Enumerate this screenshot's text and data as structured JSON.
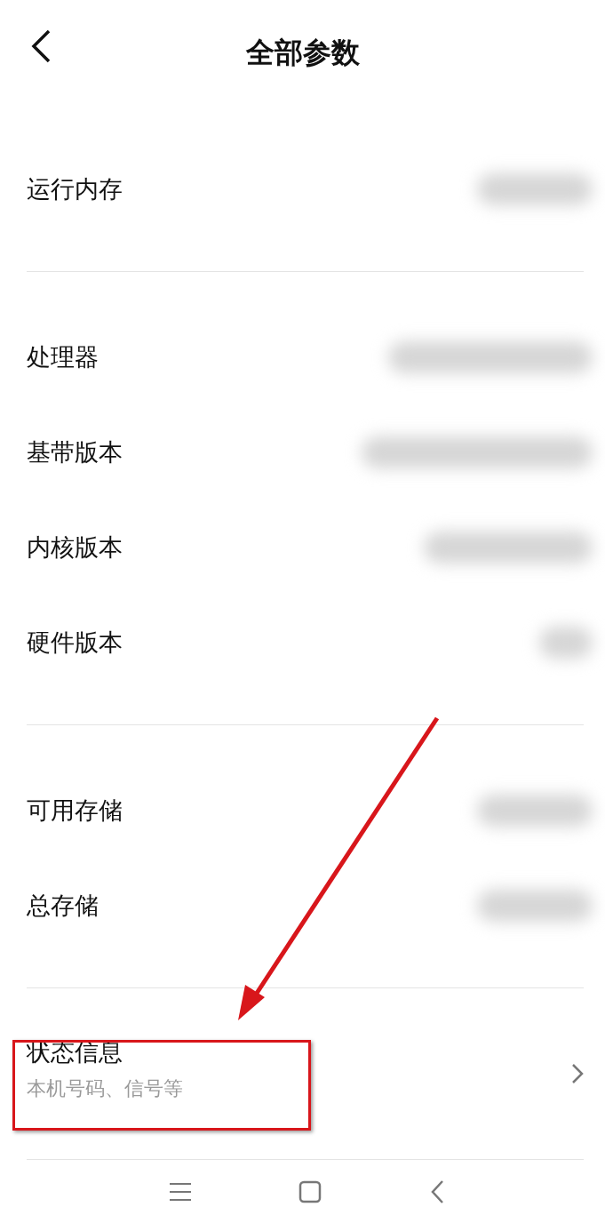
{
  "header": {
    "title": "全部参数"
  },
  "sections": [
    {
      "rows": [
        {
          "label": "运行内存",
          "blurred": true
        }
      ]
    },
    {
      "rows": [
        {
          "label": "处理器",
          "blurred": true
        },
        {
          "label": "基带版本",
          "blurred": true
        },
        {
          "label": "内核版本",
          "blurred": true
        },
        {
          "label": "硬件版本",
          "blurred": true
        }
      ]
    },
    {
      "rows": [
        {
          "label": "可用存储",
          "blurred": true
        },
        {
          "label": "总存储",
          "blurred": true
        }
      ]
    }
  ],
  "status_row": {
    "title": "状态信息",
    "subtitle": "本机号码、信号等"
  },
  "annotation": {
    "arrow": true,
    "box": true
  }
}
